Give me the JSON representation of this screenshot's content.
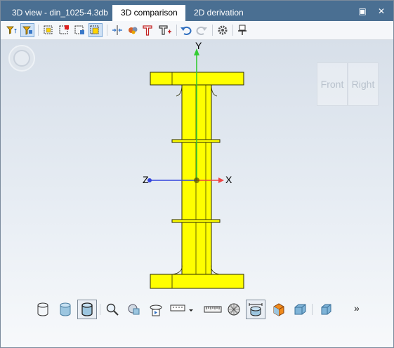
{
  "tabs": [
    {
      "label": "3D view - din_1025-4.3db",
      "active": false
    },
    {
      "label": "3D comparison",
      "active": true
    },
    {
      "label": "2D derivation",
      "active": false
    }
  ],
  "window_controls": {
    "restore": "▣",
    "close": "✕"
  },
  "viewport": {
    "axes": {
      "y": "Y",
      "x": "X",
      "z": "Z"
    },
    "view_cube": {
      "front": "Front",
      "right": "Right"
    }
  },
  "bottom_toolbar": {
    "more": "»"
  },
  "colors": {
    "tabbar": "#4a6f92",
    "beam_fill": "#ffff00",
    "axis_y": "#33cc33",
    "axis_x": "#ee4444",
    "axis_z": "#3344dd"
  }
}
